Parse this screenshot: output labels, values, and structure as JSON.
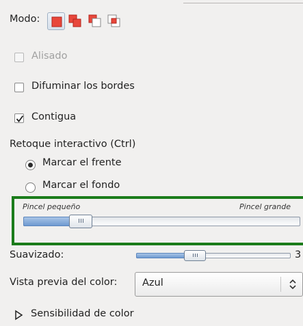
{
  "mode": {
    "label": "Modo:",
    "buttons": [
      {
        "name": "replace",
        "icon": "mode-replace-icon",
        "active": true
      },
      {
        "name": "add",
        "icon": "mode-add-icon",
        "active": false
      },
      {
        "name": "subtract",
        "icon": "mode-subtract-icon",
        "active": false
      },
      {
        "name": "intersect",
        "icon": "mode-intersect-icon",
        "active": false
      }
    ]
  },
  "options": {
    "antialias": {
      "label": "Alisado",
      "checked": false,
      "enabled": false
    },
    "feather": {
      "label": "Difuminar los bordes",
      "checked": false
    },
    "contiguous": {
      "label": "Contigua",
      "checked": true
    }
  },
  "interactive": {
    "heading": "Retoque interactivo (Ctrl)",
    "foreground": {
      "label": "Marcar el frente",
      "selected": true
    },
    "background": {
      "label": "Marcar el fondo",
      "selected": false
    }
  },
  "brush": {
    "min_label": "Pincel pequeño",
    "max_label": "Pincel grande",
    "value_fraction": 0.18
  },
  "smoothing": {
    "label": "Suavizado:",
    "value": "3",
    "value_fraction": 0.36
  },
  "preview": {
    "label": "Vista previa del color:",
    "selected": "Azul"
  },
  "sensitivity": {
    "label": "Sensibilidad de color",
    "expanded": false
  },
  "colors": {
    "highlight_frame": "#1b7c1b",
    "mode_red": "#e8473b",
    "slider_fill": "#6f9ad1"
  }
}
